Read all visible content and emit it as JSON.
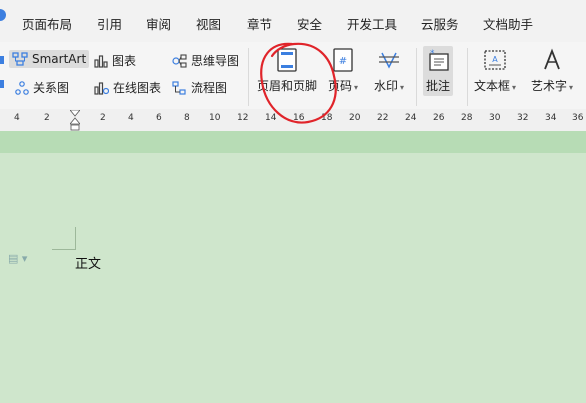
{
  "menubar": {
    "items": [
      "页面布局",
      "引用",
      "审阅",
      "视图",
      "章节",
      "安全",
      "开发工具",
      "云服务",
      "文档助手"
    ]
  },
  "toolbar": {
    "smartart": "SmartArt",
    "chart": "图表",
    "mindmap": "思维导图",
    "relation": "关系图",
    "online_chart": "在线图表",
    "flowchart": "流程图",
    "header_footer": "页眉和页脚",
    "page_number": "页码",
    "watermark": "水印",
    "comment": "批注",
    "textbox": "文本框",
    "wordart": "艺术字"
  },
  "ruler": {
    "ticks": [
      "4",
      "2",
      "2",
      "4",
      "6",
      "8",
      "10",
      "12",
      "14",
      "16",
      "18",
      "20",
      "22",
      "24",
      "26",
      "28",
      "30",
      "32",
      "34",
      "36"
    ]
  },
  "document": {
    "body_text": "正文"
  },
  "colors": {
    "doc_background": "#cfe6cc",
    "annotation": "#e0242a",
    "accent": "#3c7fe0"
  }
}
